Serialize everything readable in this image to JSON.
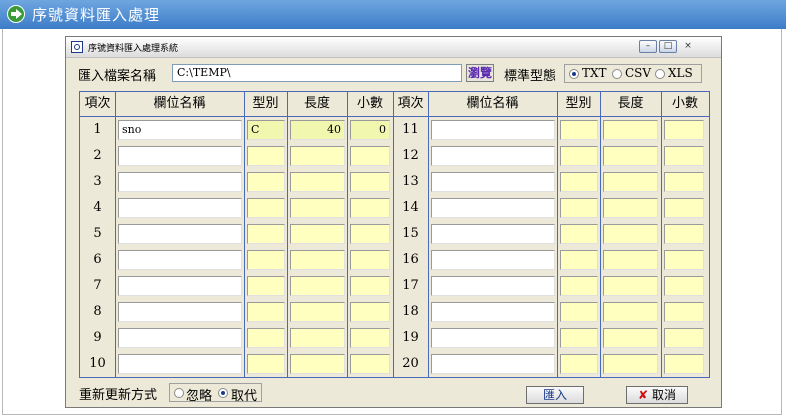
{
  "banner": {
    "title": "序號資料匯入處理"
  },
  "window": {
    "title": "序號資料匯入處理系統",
    "min": "–",
    "max": "□",
    "close": "×"
  },
  "file": {
    "label": "匯入檔案名稱",
    "path": "C:\\TEMP\\",
    "browse": "瀏覽"
  },
  "format": {
    "label": "標準型態",
    "options": [
      "TXT",
      "CSV",
      "XLS"
    ],
    "selected": "TXT"
  },
  "table": {
    "headers": [
      "項次",
      "欄位名稱",
      "型別",
      "長度",
      "小數"
    ],
    "rows_left": [
      {
        "n": "1",
        "name": "sno",
        "type": "C",
        "len": "40",
        "dec": "0"
      },
      {
        "n": "2",
        "name": "",
        "type": "",
        "len": "",
        "dec": ""
      },
      {
        "n": "3",
        "name": "",
        "type": "",
        "len": "",
        "dec": ""
      },
      {
        "n": "4",
        "name": "",
        "type": "",
        "len": "",
        "dec": ""
      },
      {
        "n": "5",
        "name": "",
        "type": "",
        "len": "",
        "dec": ""
      },
      {
        "n": "6",
        "name": "",
        "type": "",
        "len": "",
        "dec": ""
      },
      {
        "n": "7",
        "name": "",
        "type": "",
        "len": "",
        "dec": ""
      },
      {
        "n": "8",
        "name": "",
        "type": "",
        "len": "",
        "dec": ""
      },
      {
        "n": "9",
        "name": "",
        "type": "",
        "len": "",
        "dec": ""
      },
      {
        "n": "10",
        "name": "",
        "type": "",
        "len": "",
        "dec": ""
      }
    ],
    "rows_right": [
      {
        "n": "11",
        "name": "",
        "type": "",
        "len": "",
        "dec": ""
      },
      {
        "n": "12",
        "name": "",
        "type": "",
        "len": "",
        "dec": ""
      },
      {
        "n": "13",
        "name": "",
        "type": "",
        "len": "",
        "dec": ""
      },
      {
        "n": "14",
        "name": "",
        "type": "",
        "len": "",
        "dec": ""
      },
      {
        "n": "15",
        "name": "",
        "type": "",
        "len": "",
        "dec": ""
      },
      {
        "n": "16",
        "name": "",
        "type": "",
        "len": "",
        "dec": ""
      },
      {
        "n": "17",
        "name": "",
        "type": "",
        "len": "",
        "dec": ""
      },
      {
        "n": "18",
        "name": "",
        "type": "",
        "len": "",
        "dec": ""
      },
      {
        "n": "19",
        "name": "",
        "type": "",
        "len": "",
        "dec": ""
      },
      {
        "n": "20",
        "name": "",
        "type": "",
        "len": "",
        "dec": ""
      }
    ]
  },
  "update": {
    "label": "重新更新方式",
    "options": [
      "忽略",
      "取代"
    ],
    "selected": "取代"
  },
  "buttons": {
    "import": "匯入",
    "cancel": "取消"
  },
  "colors": {
    "banner": "#3d7cc8",
    "grid_line": "#4a6ab8",
    "field_yellow": "#ffffc0",
    "window_bg": "#ece9d8"
  }
}
